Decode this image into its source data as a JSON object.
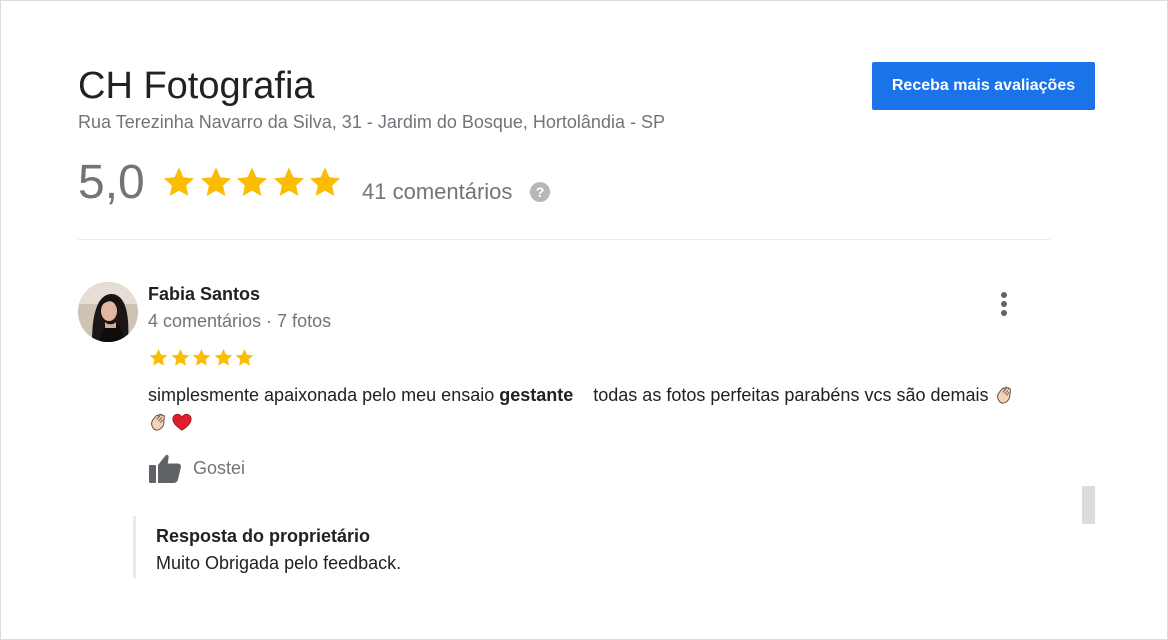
{
  "business": {
    "name": "CH Fotografia",
    "address": "Rua Terezinha Navarro da Silva, 31 - Jardim do Bosque, Hortolândia - SP",
    "cta_label": "Receba mais avaliações"
  },
  "summary": {
    "rating": "5,0",
    "stars": 5,
    "review_count": "41 comentários",
    "help_symbol": "?"
  },
  "review": {
    "author": "Fabia Santos",
    "meta": "4 comentários · 7 fotos",
    "stars": 5,
    "text_before": "simplesmente apaixonada pelo meu ensaio ",
    "text_bold": "gestante",
    "text_after": "    todas as fotos perfeitas parabéns vcs são demais ",
    "emojis": [
      "clapping-hands",
      "clapping-hands",
      "red-heart"
    ],
    "like_label": "Gostei",
    "owner_reply": {
      "title": "Resposta do proprietário",
      "text": "Muito Obrigada pelo feedback."
    }
  },
  "colors": {
    "primary_button": "#1a73e8",
    "star": "#fbbc04",
    "secondary_text": "#70757a",
    "icon_gray": "#5f6368",
    "heart": "#e11d2c"
  },
  "icons": {
    "rating_star": "star-icon",
    "help": "help-circle-icon",
    "more": "more-vertical-icon",
    "like": "thumbs-up-icon",
    "clap": "clapping-hands-icon",
    "heart": "red-heart-icon"
  }
}
